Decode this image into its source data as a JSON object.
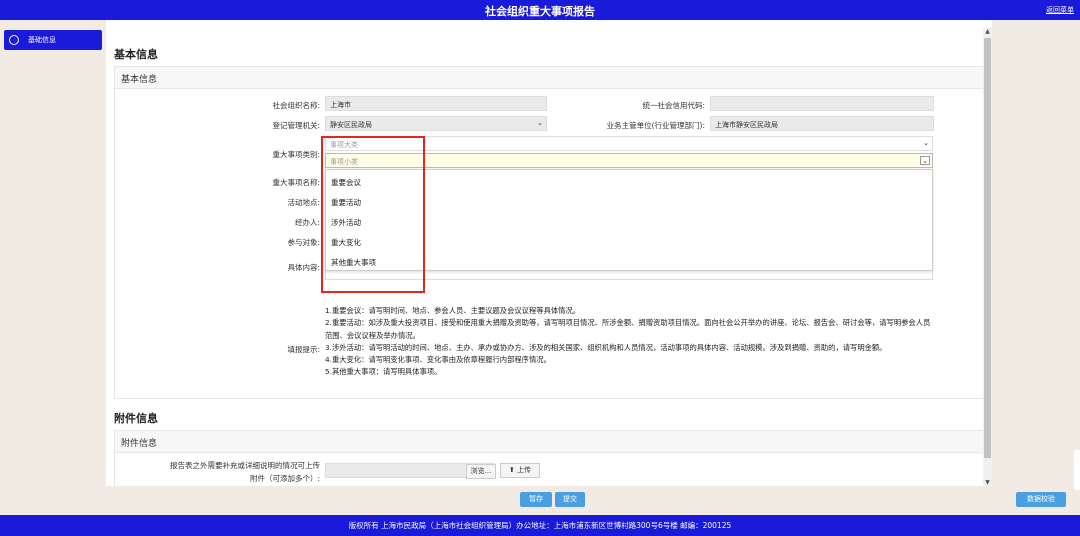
{
  "header": {
    "title": "社会组织重大事项报告",
    "back_link": "返回菜单"
  },
  "sidebar": {
    "items": [
      {
        "label": "基础信息"
      }
    ]
  },
  "basic": {
    "section_title": "基本信息",
    "panel_title": "基本信息",
    "org_name_label": "社会组织名称:",
    "org_name_value": "上海市",
    "credit_code_label": "统一社会信用代码:",
    "credit_code_value": "",
    "reg_authority_label": "登记管理机关:",
    "reg_authority_value": "静安区民政局",
    "supervisor_label": "业务主管单位(行业管理部门):",
    "supervisor_value": "上海市静安区民政局",
    "category_label": "重大事项类别:",
    "category_major_placeholder": "事项大类",
    "category_minor_placeholder": "事项小类",
    "event_name_label": "重大事项名称:",
    "location_label": "活动地点:",
    "handler_label": "经办人:",
    "participants_label": "参与对象:",
    "content_label": "具体内容:",
    "dropdown_options": [
      "重要会议",
      "重要活动",
      "涉外活动",
      "重大变化",
      "其他重大事项"
    ],
    "hint_label": "填报提示:",
    "hints": [
      "1.重要会议：请写明时间、地点、参会人员、主要议题及会议议程等具体情况。",
      "2.重要活动：如涉及重大投资项目、接受和使用重大捐赠及资助等，请写明项目情况、所涉金额、捐赠资助项目情况。面向社会公开举办的讲座、论坛、报告会、研讨会等，请写明参会人员范围、会议议程及举办情况。",
      "3.涉外活动：请写明活动的时间、地点、主办、承办或协办方、涉及的相关国家、组织机构和人员情况，活动事项的具体内容、活动规模。涉及到捐赠、资助的，请写明金额。",
      "4.重大变化：请写明变化事项、变化事由及依章程履行内部程序情况。",
      "5.其他重大事项：请写明具体事项。"
    ]
  },
  "attachment": {
    "section_title": "附件信息",
    "panel_title": "附件信息",
    "label_line1": "报告表之外需要补充或详细说明的情况可上传",
    "label_line2": "附件（可添加多个）:",
    "browse_label": "浏览...",
    "upload_label": "上传"
  },
  "actions": {
    "save_label": "暂存",
    "submit_label": "提交",
    "verify_label": "数据校验"
  },
  "footer": {
    "text": "版权所有 上海市民政局（上海市社会组织管理局）办公地址：上海市浦东新区世博村路300号6号楼 邮编：200125"
  },
  "colors": {
    "primary": "#1a1adb",
    "button": "#4a9fe0",
    "highlight": "#e8251c",
    "sidebar_bg": "#f2ebe4"
  }
}
